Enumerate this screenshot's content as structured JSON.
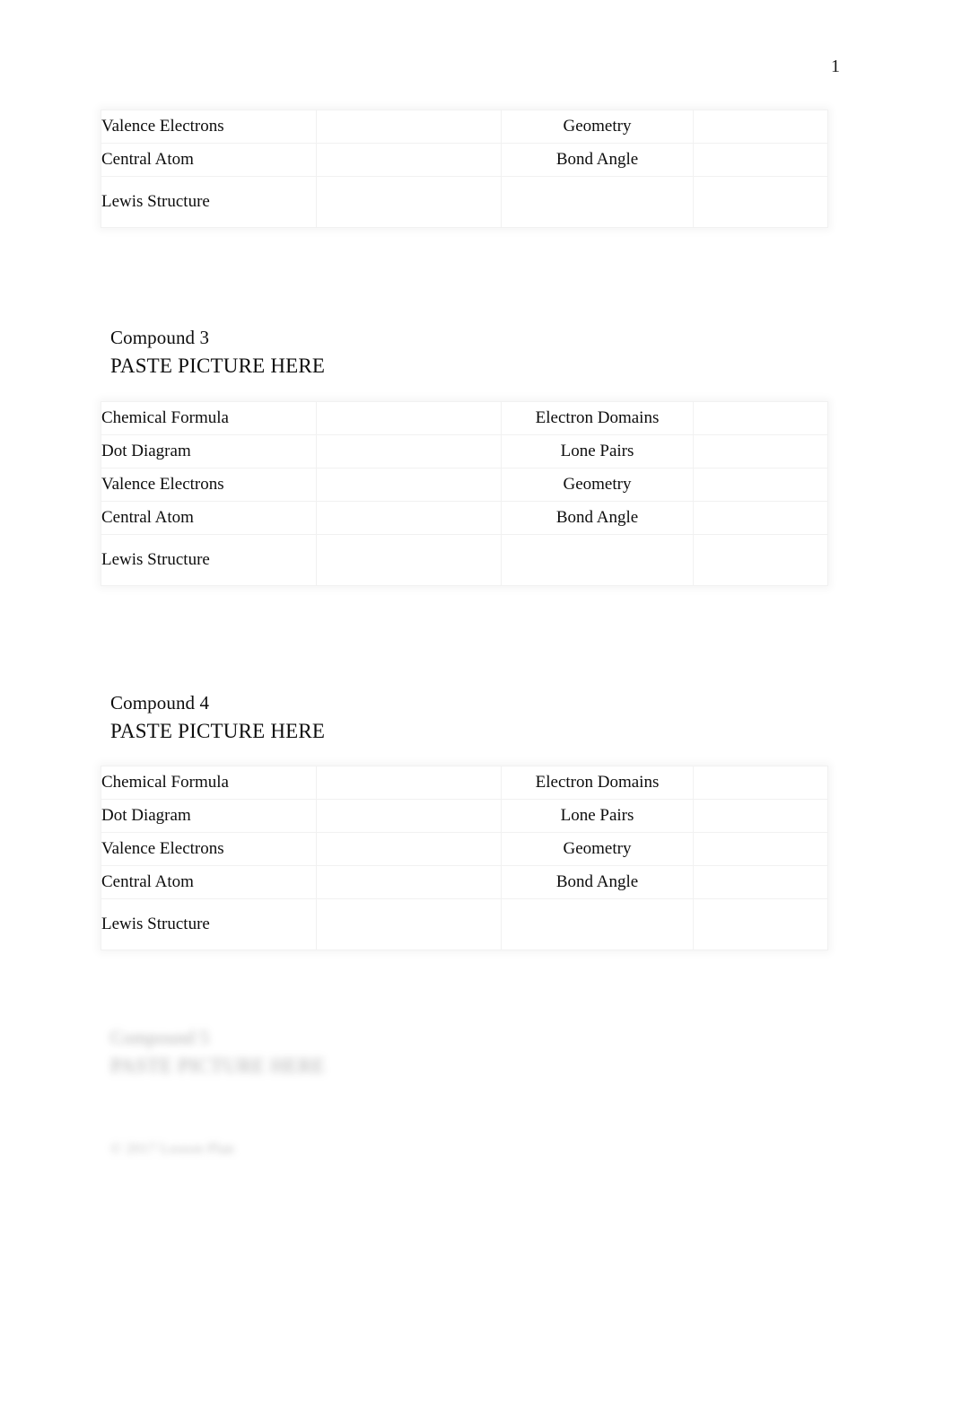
{
  "document": {
    "page_number": "1",
    "paste_picture_text": "PASTE PICTURE HERE"
  },
  "labels": {
    "chemical_formula": "Chemical Formula",
    "electron_domains": "Electron Domains",
    "dot_diagram": "Dot Diagram",
    "lone_pairs": "Lone Pairs",
    "valence_electrons": "Valence Electrons",
    "geometry": "Geometry",
    "central_atom": "Central Atom",
    "bond_angle": "Bond Angle",
    "lewis_structure": "Lewis Structure"
  },
  "table_partial_top": {
    "rows": [
      {
        "label_left": "Valence Electrons",
        "value_left": "",
        "label_right": "Geometry",
        "value_right": ""
      },
      {
        "label_left": "Central Atom",
        "value_left": "",
        "label_right": "Bond Angle",
        "value_right": ""
      },
      {
        "label_left": "Lewis Structure",
        "value_left": "",
        "label_right": "",
        "value_right": ""
      }
    ]
  },
  "compound_3": {
    "title": "Compound 3",
    "paste_picture": "PASTE PICTURE HERE",
    "rows": [
      {
        "label_left": "Chemical Formula",
        "value_left": "",
        "label_right": "Electron Domains",
        "value_right": ""
      },
      {
        "label_left": "Dot Diagram",
        "value_left": "",
        "label_right": "Lone Pairs",
        "value_right": ""
      },
      {
        "label_left": "Valence Electrons",
        "value_left": "",
        "label_right": "Geometry",
        "value_right": ""
      },
      {
        "label_left": "Central Atom",
        "value_left": "",
        "label_right": "Bond Angle",
        "value_right": ""
      },
      {
        "label_left": "Lewis Structure",
        "value_left": "",
        "label_right": "",
        "value_right": ""
      }
    ]
  },
  "compound_4": {
    "title": "Compound 4",
    "paste_picture": "PASTE PICTURE HERE",
    "rows": [
      {
        "label_left": "Chemical Formula",
        "value_left": "",
        "label_right": "Electron Domains",
        "value_right": ""
      },
      {
        "label_left": "Dot Diagram",
        "value_left": "",
        "label_right": "Lone Pairs",
        "value_right": ""
      },
      {
        "label_left": "Valence Electrons",
        "value_left": "",
        "label_right": "Geometry",
        "value_right": ""
      },
      {
        "label_left": "Central Atom",
        "value_left": "",
        "label_right": "Bond Angle",
        "value_right": ""
      },
      {
        "label_left": "Lewis Structure",
        "value_left": "",
        "label_right": "",
        "value_right": ""
      }
    ]
  },
  "compound_5_obscured": {
    "title": "Compound 5",
    "paste_picture": "PASTE PICTURE HERE"
  },
  "footer_obscured": {
    "text": "© 2017 Lesson Plan"
  }
}
